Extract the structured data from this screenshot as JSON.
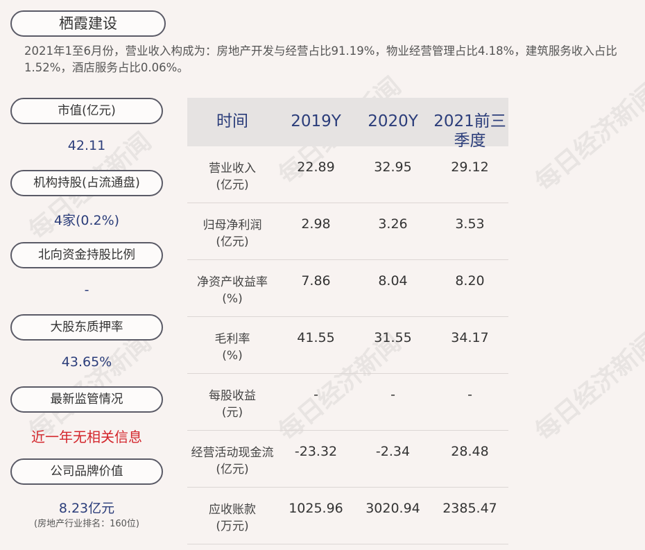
{
  "title": "栖霞建设",
  "intro": "2021年1至6月份，营业收入构成为：房地产开发与经营占比91.19%，物业经营管理占比4.18%，建筑服务收入占比1.52%，酒店服务占比0.06%。",
  "sidebar": {
    "items": [
      {
        "label": "市值(亿元)",
        "value": "42.11"
      },
      {
        "label": "机构持股(占流通盘)",
        "value": "4家(0.2%)"
      },
      {
        "label": "北向资金持股比例",
        "value": "-"
      },
      {
        "label": "大股东质押率",
        "value": "43.65%"
      },
      {
        "label": "最新监管情况",
        "value": "近一年无相关信息"
      },
      {
        "label": "公司品牌价值",
        "value": "8.23亿元"
      }
    ],
    "brand_note": "(房地产行业排名：160位)"
  },
  "table": {
    "headers": [
      "时间",
      "2019Y",
      "2020Y",
      "2021前三季度"
    ],
    "rows": [
      {
        "label": "营业收入\n(亿元)",
        "values": [
          "22.89",
          "32.95",
          "29.12"
        ]
      },
      {
        "label": "归母净利润\n(亿元)",
        "values": [
          "2.98",
          "3.26",
          "3.53"
        ]
      },
      {
        "label": "净资产收益率\n(%)",
        "values": [
          "7.86",
          "8.04",
          "8.20"
        ]
      },
      {
        "label": "毛利率\n(%)",
        "values": [
          "41.55",
          "31.55",
          "34.17"
        ]
      },
      {
        "label": "每股收益\n(元)",
        "values": [
          "-",
          "-",
          "-"
        ]
      },
      {
        "label": "经营活动现金流\n(亿元)",
        "values": [
          "-23.32",
          "-2.34",
          "28.48"
        ]
      },
      {
        "label": "应收账款\n(万元)",
        "values": [
          "1025.96",
          "3020.94",
          "2385.47"
        ]
      }
    ]
  },
  "watermark": "每日经济新闻",
  "colors": {
    "accent": "#2b3d7a",
    "alert": "#d3262c",
    "background": "#f8f3f1"
  }
}
